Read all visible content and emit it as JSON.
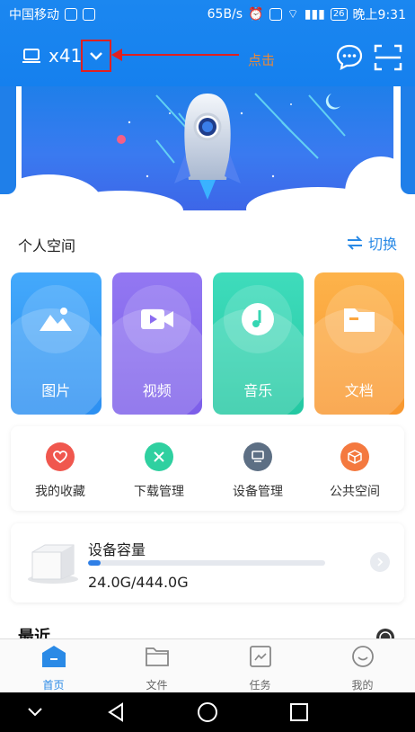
{
  "status_bar": {
    "carrier": "中国移动",
    "speed": "65B/s",
    "battery": "26",
    "time": "晚上9:31"
  },
  "header": {
    "device_label": "x41",
    "annotation": "点击"
  },
  "personal_space": {
    "title": "个人空间",
    "switch_label": "切换",
    "cards": [
      {
        "label": "图片",
        "color": "#3aa0f7"
      },
      {
        "label": "视频",
        "color": "#8b6cf0"
      },
      {
        "label": "音乐",
        "color": "#35d6b3"
      },
      {
        "label": "文档",
        "color": "#fba63f"
      }
    ]
  },
  "quick_actions": [
    {
      "label": "我的收藏",
      "icon": "heart-icon",
      "color": "#f0574e"
    },
    {
      "label": "下载管理",
      "icon": "tools-icon",
      "color": "#2fd0a0"
    },
    {
      "label": "设备管理",
      "icon": "device-icon",
      "color": "#5d6f84"
    },
    {
      "label": "公共空间",
      "icon": "box-icon",
      "color": "#f4793f"
    }
  ],
  "storage": {
    "title": "设备容量",
    "used_total": "24.0G/444.0G",
    "used_fraction": 0.054
  },
  "recent": {
    "title": "最近"
  },
  "tabbar": [
    {
      "label": "首页",
      "icon": "home-icon",
      "active": true
    },
    {
      "label": "文件",
      "icon": "folder-icon",
      "active": false
    },
    {
      "label": "任务",
      "icon": "task-icon",
      "active": false
    },
    {
      "label": "我的",
      "icon": "profile-icon",
      "active": false
    }
  ],
  "colors": {
    "primary": "#1b87f0",
    "annotation": "#e02020"
  }
}
